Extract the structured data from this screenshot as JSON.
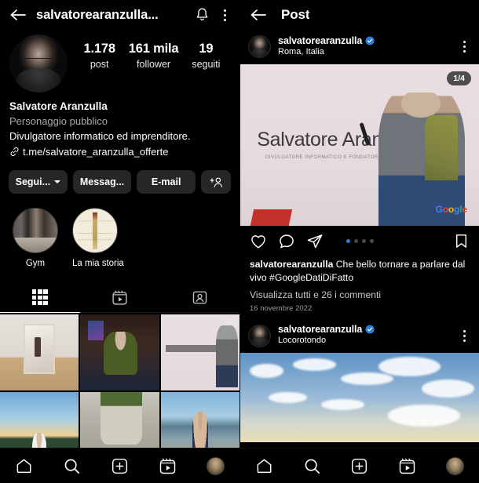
{
  "app": "Instagram",
  "left_pane": {
    "topbar": {
      "back_icon": "back-arrow-icon",
      "title": "salvatorearanzulla...",
      "bell_icon": "bell-icon",
      "menu_icon": "kebab-menu-icon"
    },
    "profile": {
      "avatar": "profile-avatar",
      "stats": [
        {
          "num": "1.178",
          "label": "post"
        },
        {
          "num": "161 mila",
          "label": "follower"
        },
        {
          "num": "19",
          "label": "seguiti"
        }
      ],
      "name": "Salvatore Aranzulla",
      "category": "Personaggio pubblico",
      "description": "Divulgatore informatico ed imprenditore.",
      "link_icon": "link-icon",
      "link": "t.me/salvatore_aranzulla_offerte"
    },
    "actions": {
      "follow": "Segui...",
      "message": "Messag...",
      "email": "E-mail",
      "add_person_icon": "add-person-icon"
    },
    "highlights": [
      {
        "label": "Gym"
      },
      {
        "label": "La mia storia"
      }
    ],
    "tabs": [
      {
        "name": "grid",
        "icon": "grid-icon",
        "active": true
      },
      {
        "name": "reels",
        "icon": "reels-icon",
        "active": false
      },
      {
        "name": "tagged",
        "icon": "tagged-icon",
        "active": false
      }
    ],
    "photo_count": 6
  },
  "right_pane": {
    "topbar": {
      "back_icon": "back-arrow-icon",
      "title": "Post"
    },
    "post1": {
      "username": "salvatorearanzulla",
      "verified": true,
      "location": "Roma, Italia",
      "menu_icon": "kebab-menu-icon",
      "carousel_badge": "1/4",
      "slide_title": "Salvatore Aranzulla",
      "slide_subtitle": "DIVULGATORE INFORMATICO E FONDATORE DI ARANZULLA.IT",
      "watermark": "Google",
      "actions": {
        "like_icon": "heart-icon",
        "comment_icon": "comment-icon",
        "share_icon": "share-icon",
        "save_icon": "bookmark-icon"
      },
      "carousel_dots": 4,
      "carousel_active": 1,
      "caption_user": "salvatorearanzulla",
      "caption_text": " Che bello tornare a parlare dal vivo #GoogleDatiDiFatto",
      "comments": "Visualizza tutti e 26 i commenti",
      "date": "16 novembre 2022"
    },
    "post2": {
      "username": "salvatorearanzulla",
      "verified": true,
      "location": "Locorotondo",
      "menu_icon": "kebab-menu-icon"
    }
  },
  "bottom_nav": [
    {
      "name": "home",
      "icon": "home-icon"
    },
    {
      "name": "search",
      "icon": "search-icon"
    },
    {
      "name": "create",
      "icon": "plus-square-icon"
    },
    {
      "name": "reels",
      "icon": "reels-icon"
    },
    {
      "name": "profile",
      "icon": "profile-avatar-icon"
    }
  ],
  "colors": {
    "background": "#000000",
    "button_bg": "#262626",
    "verified_blue": "#2b7ddb",
    "muted_text": "#a8a8a8"
  }
}
